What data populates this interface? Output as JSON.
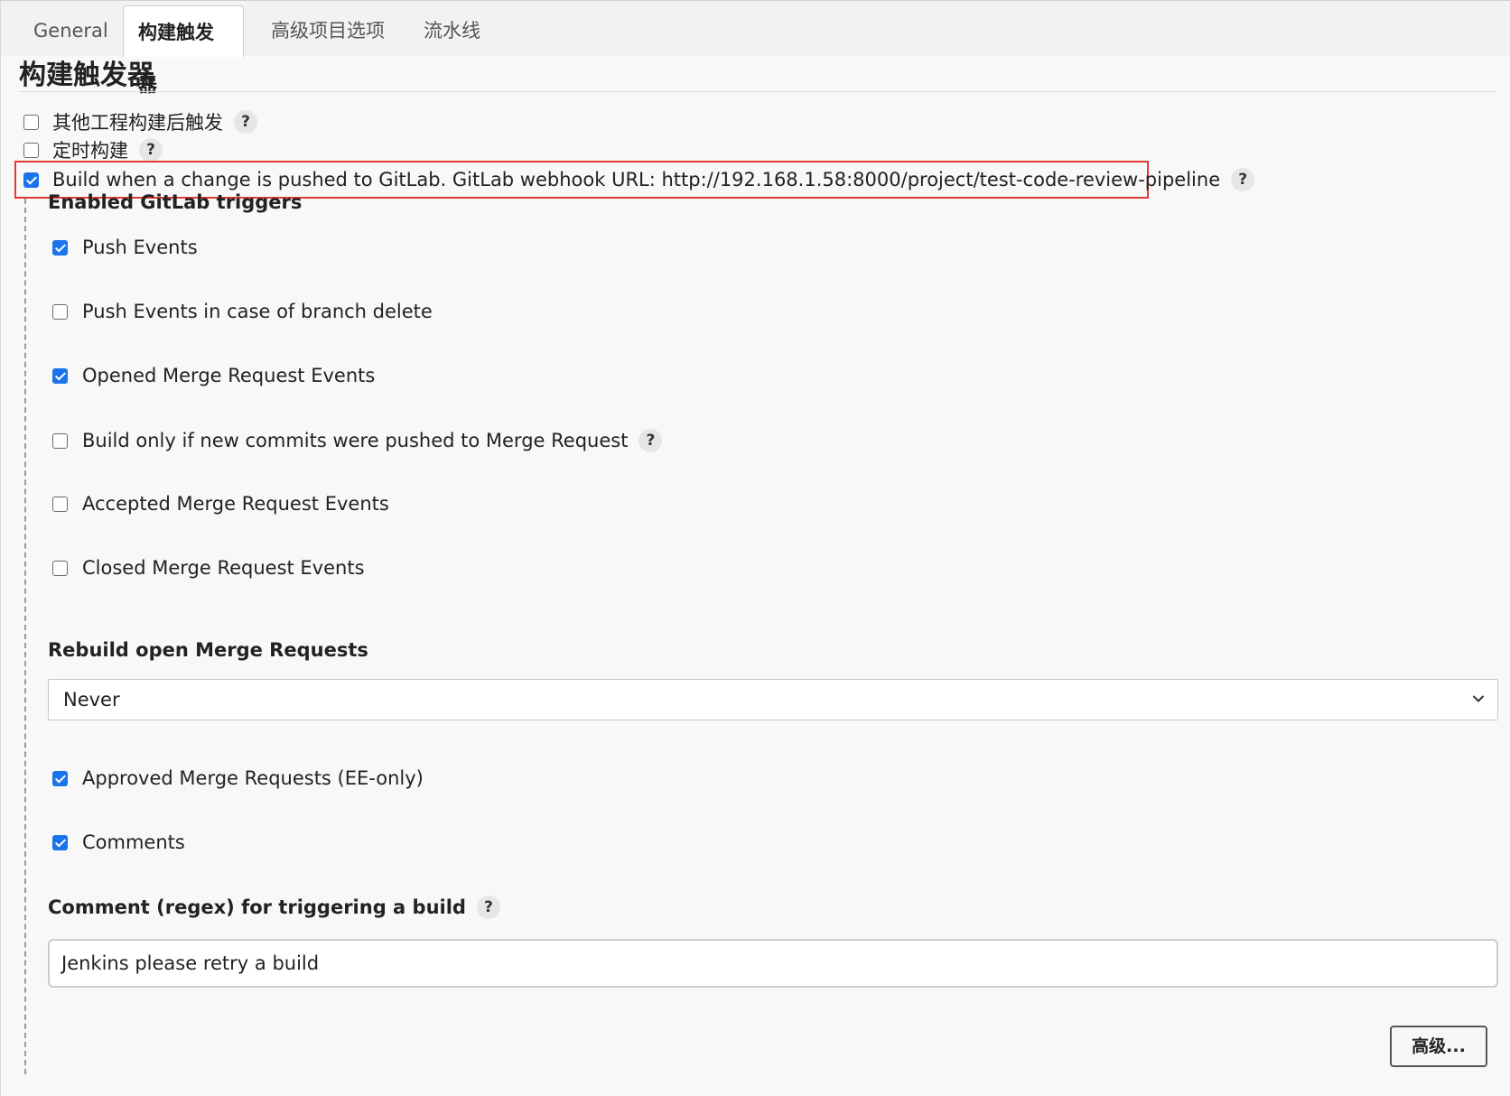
{
  "tabs": [
    {
      "label": "General",
      "active": false
    },
    {
      "label": "构建触发器",
      "active": true
    },
    {
      "label": "高级项目选项",
      "active": false
    },
    {
      "label": "流水线",
      "active": false
    }
  ],
  "section": {
    "title": "构建触发器"
  },
  "triggers": [
    {
      "label": "其他工程构建后触发",
      "checked": false,
      "help": "?"
    },
    {
      "label": "定时构建",
      "checked": false,
      "help": "?"
    },
    {
      "label": "Build when a change is pushed to GitLab. GitLab webhook URL: http://192.168.1.58:8000/project/test-code-review-pipeline",
      "checked": true,
      "help": "?"
    }
  ],
  "gitlab": {
    "enabled_heading": "Enabled GitLab triggers",
    "events": [
      {
        "label": "Push Events",
        "checked": true
      },
      {
        "label": "Push Events in case of branch delete",
        "checked": false
      },
      {
        "label": "Opened Merge Request Events",
        "checked": true
      },
      {
        "label": "Build only if new commits were pushed to Merge Request",
        "checked": false,
        "help": "?"
      },
      {
        "label": "Accepted Merge Request Events",
        "checked": false
      },
      {
        "label": "Closed Merge Request Events",
        "checked": false
      }
    ],
    "rebuild_heading": "Rebuild open Merge Requests",
    "rebuild_value": "Never",
    "extra_events": [
      {
        "label": "Approved Merge Requests (EE-only)",
        "checked": true
      },
      {
        "label": "Comments",
        "checked": true
      }
    ],
    "comment_heading": "Comment (regex) for triggering a build",
    "comment_help": "?",
    "comment_value": "Jenkins please retry a build",
    "advanced_button": "高级..."
  }
}
